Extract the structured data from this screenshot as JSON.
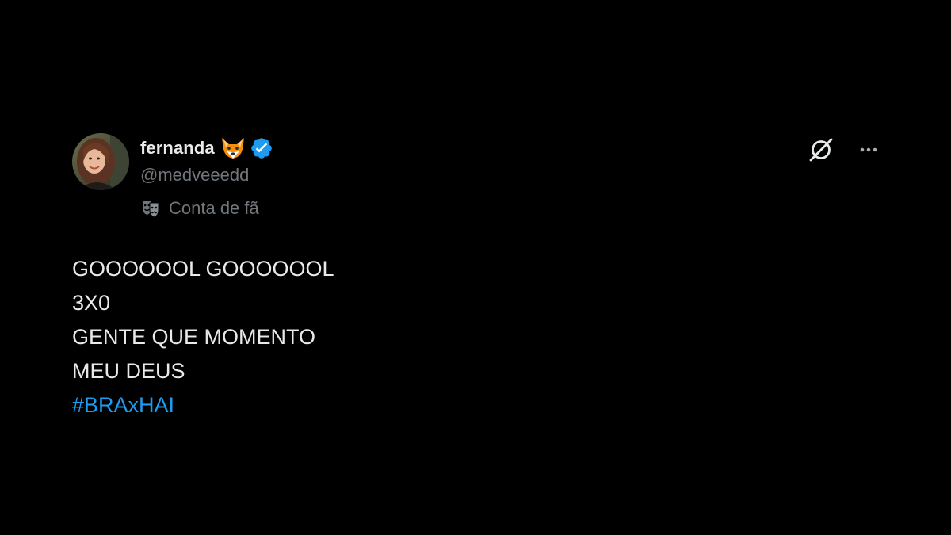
{
  "author": {
    "display_name": "fernanda",
    "name_emoji": "fox-face-emoji",
    "verified": true,
    "verified_color": "#1d9bf0",
    "handle": "@medveeedd",
    "label_icon": "theater-masks-icon",
    "label_text": "Conta de fã",
    "avatar": "avatar-photo"
  },
  "actions": {
    "grok_icon": "grok-icon",
    "more_icon": "more-horizontal-icon"
  },
  "tweet": {
    "lines": [
      "GOOOOOOL GOOOOOOL",
      "3X0",
      "GENTE QUE MOMENTO",
      "MEU DEUS"
    ],
    "hashtag": "#BRAxHAI"
  },
  "colors": {
    "background": "#000000",
    "text_primary": "#e7e9ea",
    "text_secondary": "#71767b",
    "link": "#1d9bf0"
  }
}
